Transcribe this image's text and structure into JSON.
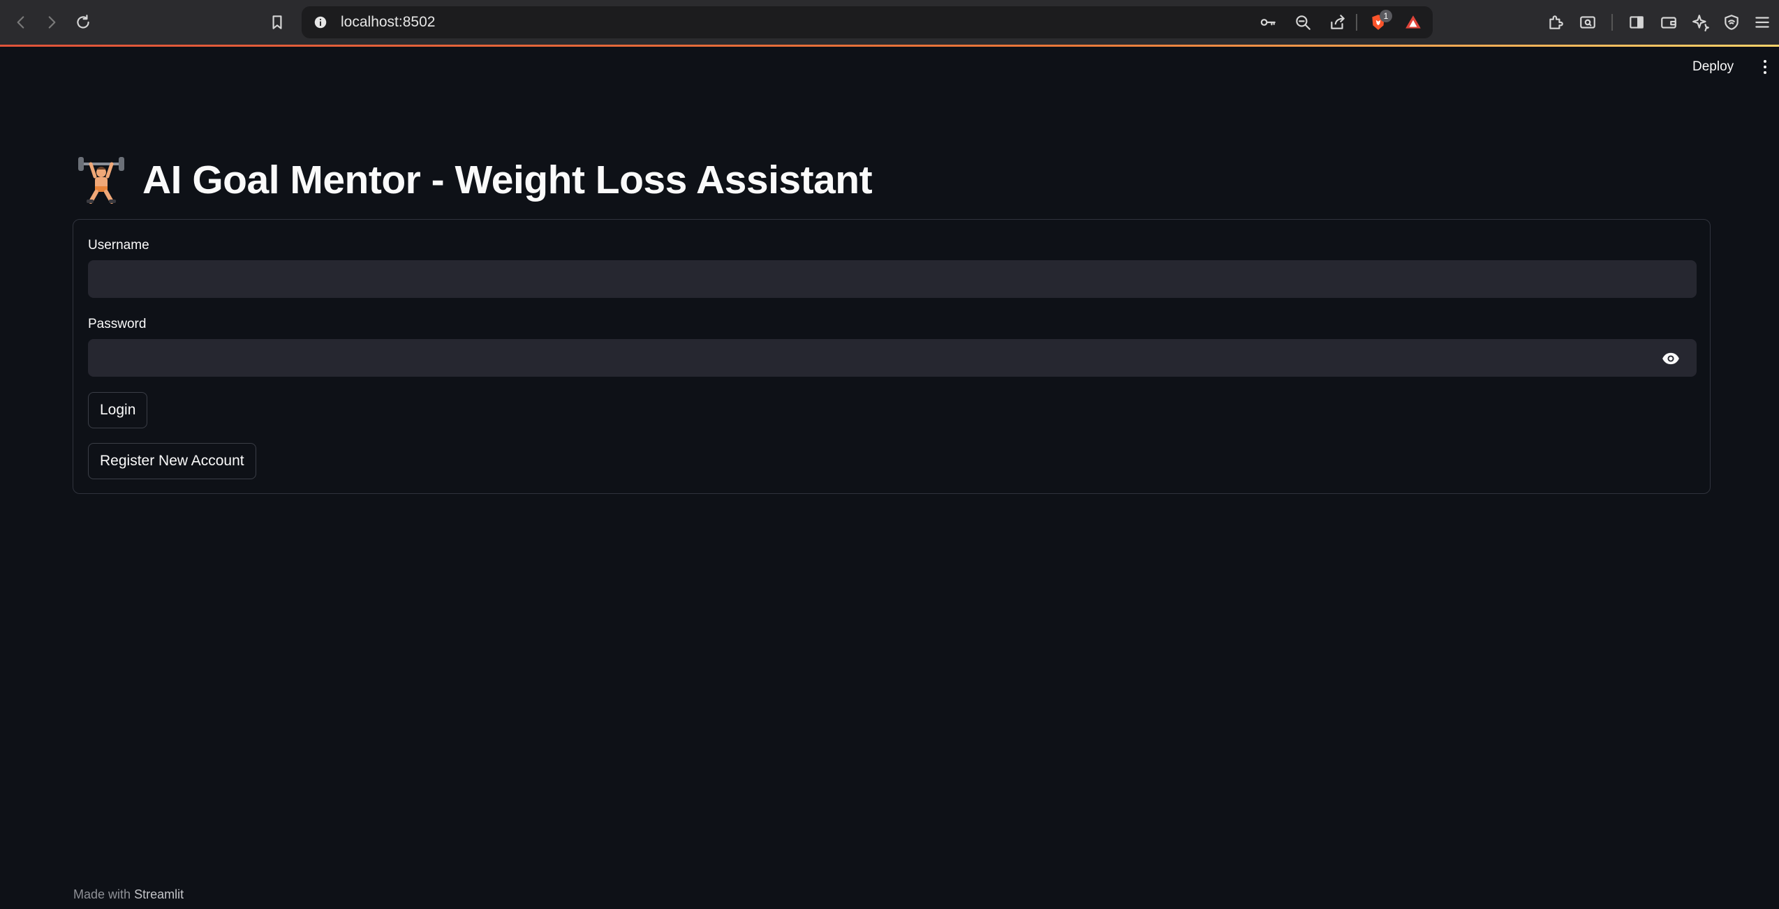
{
  "browser": {
    "url": "localhost:8502",
    "brave_badge_count": "1"
  },
  "header": {
    "deploy_label": "Deploy"
  },
  "page": {
    "title": "AI Goal Mentor - Weight Loss Assistant",
    "title_icon": "weightlifter-emoji"
  },
  "form": {
    "username_label": "Username",
    "username_value": "",
    "password_label": "Password",
    "password_value": "",
    "login_label": "Login",
    "register_label": "Register New Account"
  },
  "footer": {
    "made_with": "Made with",
    "brand": "Streamlit"
  },
  "colors": {
    "background": "#0e1117",
    "input_background": "#262730",
    "border": "#30333d",
    "text": "#fafafa",
    "chrome": "#2b2b2e",
    "urlbar": "#1c1c1e",
    "brave_orange": "#fb542b"
  }
}
